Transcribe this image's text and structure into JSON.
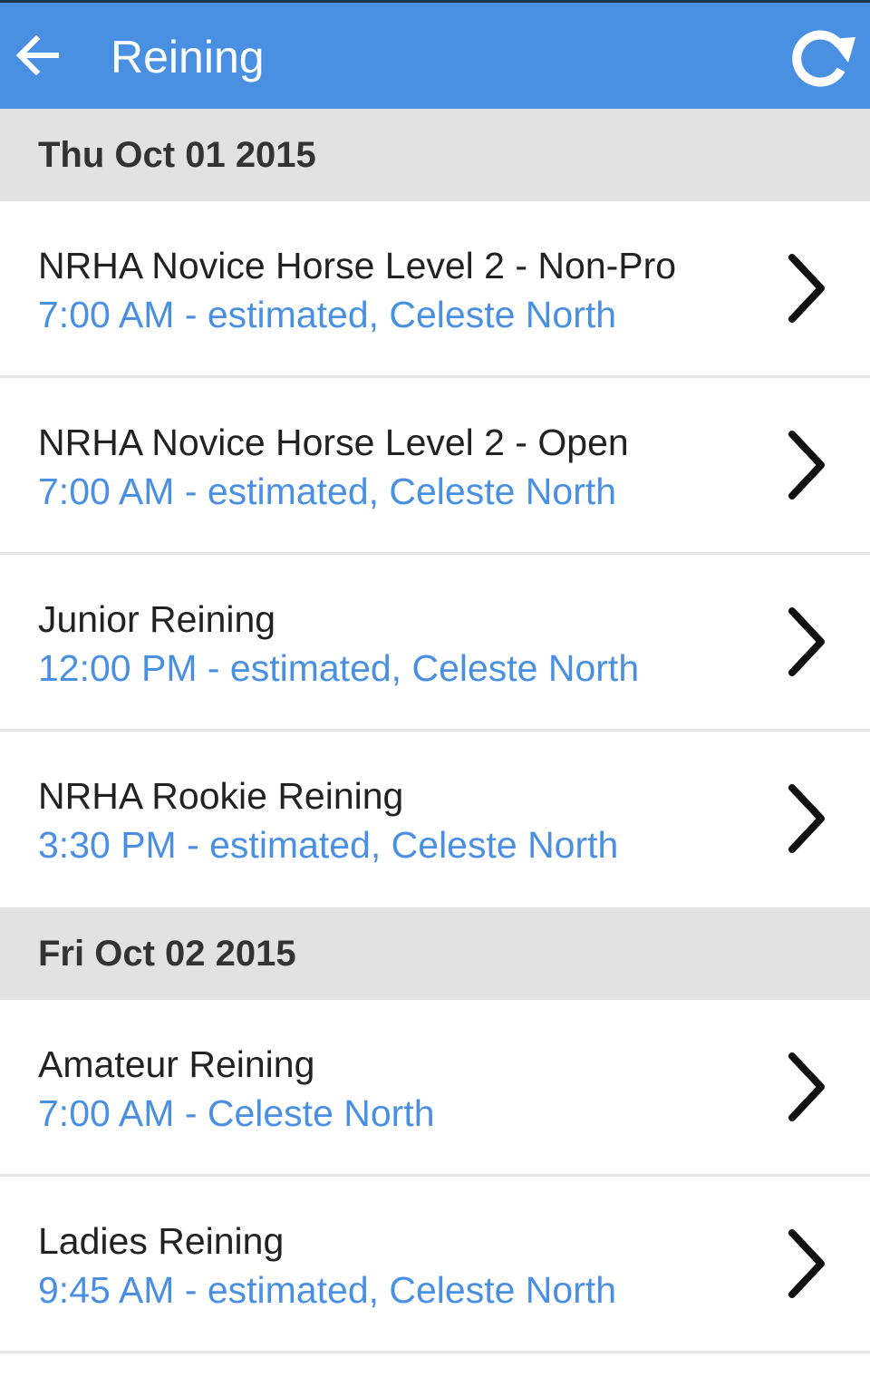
{
  "header": {
    "title": "Reining",
    "accent_color": "#4a90e2",
    "back_icon": "arrow-left-icon",
    "refresh_icon": "refresh-icon"
  },
  "sections": [
    {
      "date": "Thu Oct 01 2015",
      "items": [
        {
          "title": "NRHA Novice Horse Level 2 - Non-Pro",
          "subtitle": "7:00 AM - estimated, Celeste North"
        },
        {
          "title": "NRHA Novice Horse Level 2 - Open",
          "subtitle": "7:00 AM - estimated, Celeste North"
        },
        {
          "title": "Junior Reining",
          "subtitle": "12:00 PM - estimated, Celeste North"
        },
        {
          "title": "NRHA Rookie Reining",
          "subtitle": "3:30 PM - estimated, Celeste North"
        }
      ]
    },
    {
      "date": "Fri Oct 02 2015",
      "items": [
        {
          "title": "Amateur Reining",
          "subtitle": "7:00 AM - Celeste North"
        },
        {
          "title": "Ladies Reining",
          "subtitle": "9:45 AM - estimated, Celeste North"
        }
      ]
    }
  ]
}
